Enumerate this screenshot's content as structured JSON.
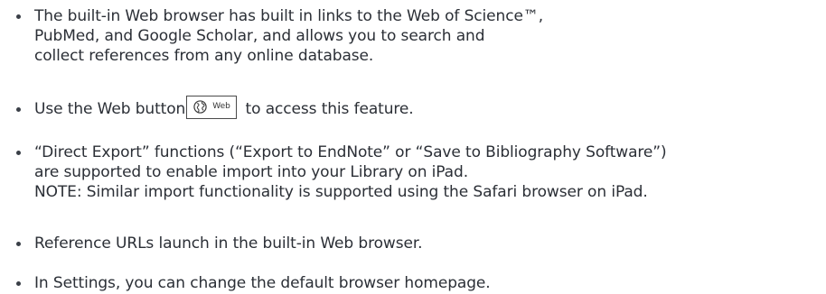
{
  "bullets": [
    {
      "lines": [
        "The built-in Web browser has built in links to the Web of Science™,",
        "PubMed, and Google Scholar, and allows you to search and",
        "collect references from any online database."
      ]
    },
    {
      "before": "Use the Web button",
      "button_label": "Web",
      "button_icon": "globe-icon",
      "after": "to access this feature."
    },
    {
      "lines": [
        "“Direct Export” functions (“Export to EndNote” or “Save to Bibliography Software”)",
        "are supported to enable import into your Library on iPad.",
        "NOTE: Similar import functionality is supported using the Safari browser on iPad."
      ]
    },
    {
      "lines": [
        "Reference URLs launch in the built-in Web browser."
      ]
    },
    {
      "lines": [
        "In Settings, you can change the default browser homepage."
      ]
    }
  ]
}
